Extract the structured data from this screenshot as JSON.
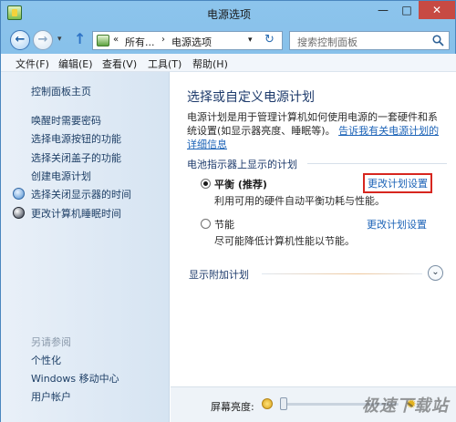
{
  "window": {
    "title": "电源选项",
    "minimize_glyph": "—",
    "maximize_glyph": "□",
    "close_glyph": "✕"
  },
  "address": {
    "back_glyph": "←",
    "forward_glyph": "→",
    "dropdown_glyph": "▾",
    "up_glyph": "↑",
    "part1": "所有...",
    "sep_glyph": "«",
    "sep2_glyph": "›",
    "part2": "电源选项",
    "refresh_glyph": "↻",
    "search_placeholder": "搜索控制面板"
  },
  "menu": [
    "文件(F)",
    "编辑(E)",
    "查看(V)",
    "工具(T)",
    "帮助(H)"
  ],
  "sidebar": {
    "home": "控制面板主页",
    "links": [
      "唤醒时需要密码",
      "选择电源按钮的功能",
      "选择关闭盖子的功能",
      "创建电源计划",
      "选择关闭显示器的时间",
      "更改计算机睡眠时间"
    ],
    "see_also_heading": "另请参阅",
    "see_also": [
      "个性化",
      "Windows 移动中心",
      "用户帐户"
    ]
  },
  "main": {
    "title": "选择或自定义电源计划",
    "description": "电源计划是用于管理计算机如何使用电源的一套硬件和系统设置(如显示器亮度、睡眠等)。",
    "description_link": "告诉我有关电源计划的详细信息",
    "group_heading": "电池指示器上显示的计划",
    "plans": [
      {
        "name": "平衡 (推荐)",
        "description": "利用可用的硬件自动平衡功耗与性能。",
        "change_link": "更改计划设置",
        "selected": true
      },
      {
        "name": "节能",
        "description": "尽可能降低计算机性能以节能。",
        "change_link": "更改计划设置",
        "selected": false
      }
    ],
    "more_plans": "显示附加计划",
    "expand_glyph": "⌄",
    "brightness_label": "屏幕亮度:",
    "brightness_level": 0,
    "watermark": "极速下载站"
  },
  "colors": {
    "link": "#1c63b7",
    "highlight_box": "#d7261f",
    "close_button": "#c74a43"
  }
}
